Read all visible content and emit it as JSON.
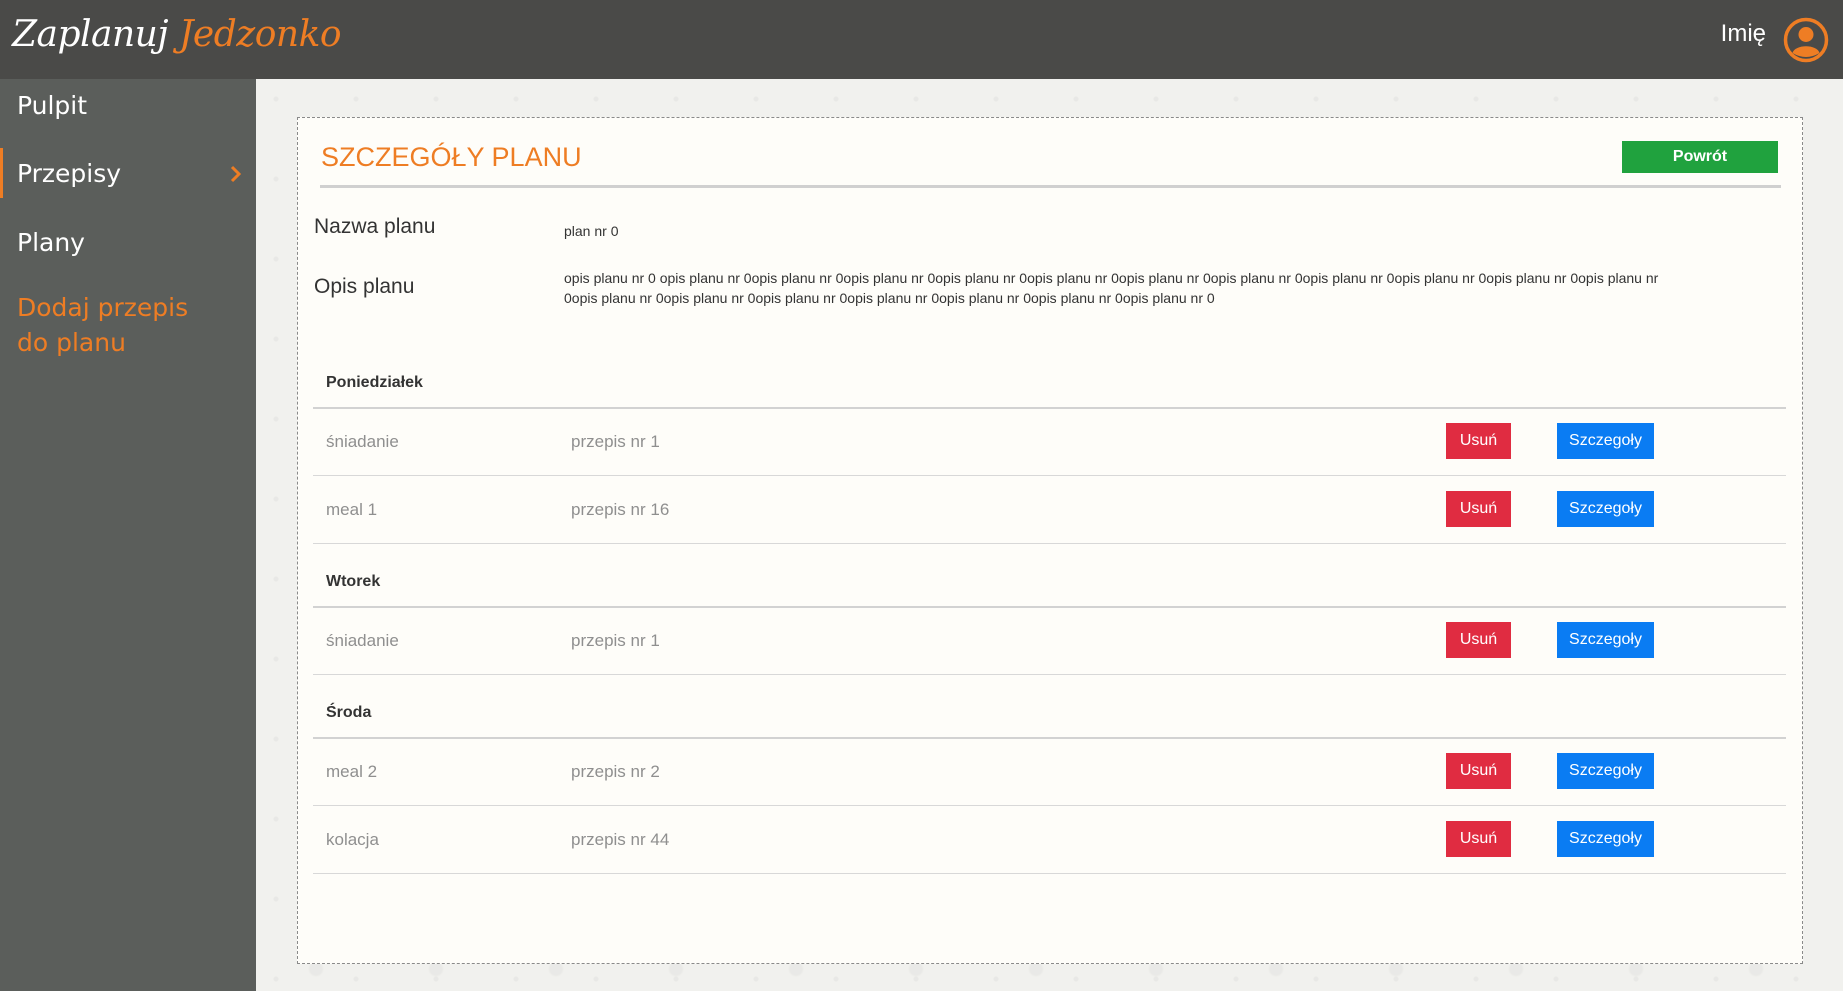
{
  "header": {
    "logo_white": "Zaplanuj",
    "logo_orange": "Jedzonko",
    "user_name": "Imię"
  },
  "sidebar": {
    "items": [
      {
        "label": "Pulpit"
      },
      {
        "label": "Przepisy"
      },
      {
        "label": "Plany"
      },
      {
        "label_line1": "Dodaj przepis",
        "label_line2": "do planu"
      }
    ]
  },
  "main": {
    "title": "SZCZEGÓŁY PLANU",
    "back_label": "Powrót",
    "plan_name_label": "Nazwa planu",
    "plan_name_value": "plan nr 0",
    "plan_desc_label": "Opis planu",
    "plan_desc_line1": "opis planu nr 0 opis planu nr 0opis planu nr 0opis planu nr 0opis planu nr 0opis planu nr 0opis planu nr 0opis planu nr 0opis planu nr 0opis planu nr 0opis planu nr 0opis planu nr",
    "plan_desc_line2": "0opis planu nr 0opis planu nr 0opis planu nr 0opis planu nr 0opis planu nr 0opis planu nr 0opis planu nr 0",
    "delete_label": "Usuń",
    "details_label": "Szczegoły",
    "days": [
      {
        "name": "Poniedziałek",
        "meals": [
          {
            "meal": "śniadanie",
            "recipe": "przepis nr 1"
          },
          {
            "meal": "meal 1",
            "recipe": "przepis nr 16"
          }
        ]
      },
      {
        "name": "Wtorek",
        "meals": [
          {
            "meal": "śniadanie",
            "recipe": "przepis nr 1"
          }
        ]
      },
      {
        "name": "Środa",
        "meals": [
          {
            "meal": "meal 2",
            "recipe": "przepis nr 2"
          },
          {
            "meal": "kolacja",
            "recipe": "przepis nr 44"
          }
        ]
      }
    ]
  },
  "colors": {
    "accent": "#ee7d24",
    "topbar": "#4a4a48",
    "sidebar": "#5b5e5b",
    "back_button": "#20a23e",
    "delete_button": "#e02c41",
    "details_button": "#0a7cf3"
  },
  "icons": [
    "user-circle-icon",
    "chevron-right-icon"
  ]
}
